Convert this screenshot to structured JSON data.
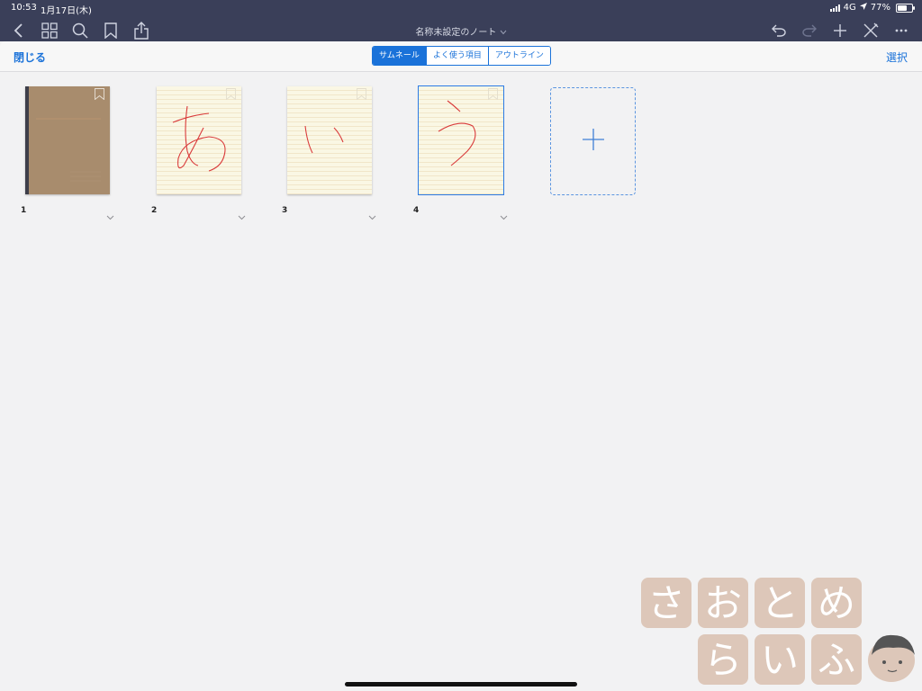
{
  "status": {
    "time": "10:53",
    "date": "1月17日(木)",
    "network": "4G",
    "battery": "77%",
    "battery_level": 0.77
  },
  "header": {
    "title": "名称未設定のノート"
  },
  "toolbar": {
    "close_label": "閉じる",
    "select_label": "選択"
  },
  "tabs": [
    {
      "label": "サムネール",
      "active": true
    },
    {
      "label": "よく使う項目",
      "active": false
    },
    {
      "label": "アウトライン",
      "active": false
    }
  ],
  "pages": [
    {
      "number": "1",
      "type": "cover",
      "character": ""
    },
    {
      "number": "2",
      "type": "paper",
      "character": "あ"
    },
    {
      "number": "3",
      "type": "paper",
      "character": "い"
    },
    {
      "number": "4",
      "type": "paper",
      "character": "う"
    }
  ],
  "selected_page": "4",
  "add_page": {
    "icon": "plus-icon"
  },
  "watermark": {
    "line1": "さおとめ",
    "line2": "らいふ"
  },
  "colors": {
    "accent": "#1a72d9",
    "topbar": "#3a3f59",
    "ink": "#d93a3a",
    "cover": "#a88c6d",
    "paper": "#faf7e4"
  }
}
